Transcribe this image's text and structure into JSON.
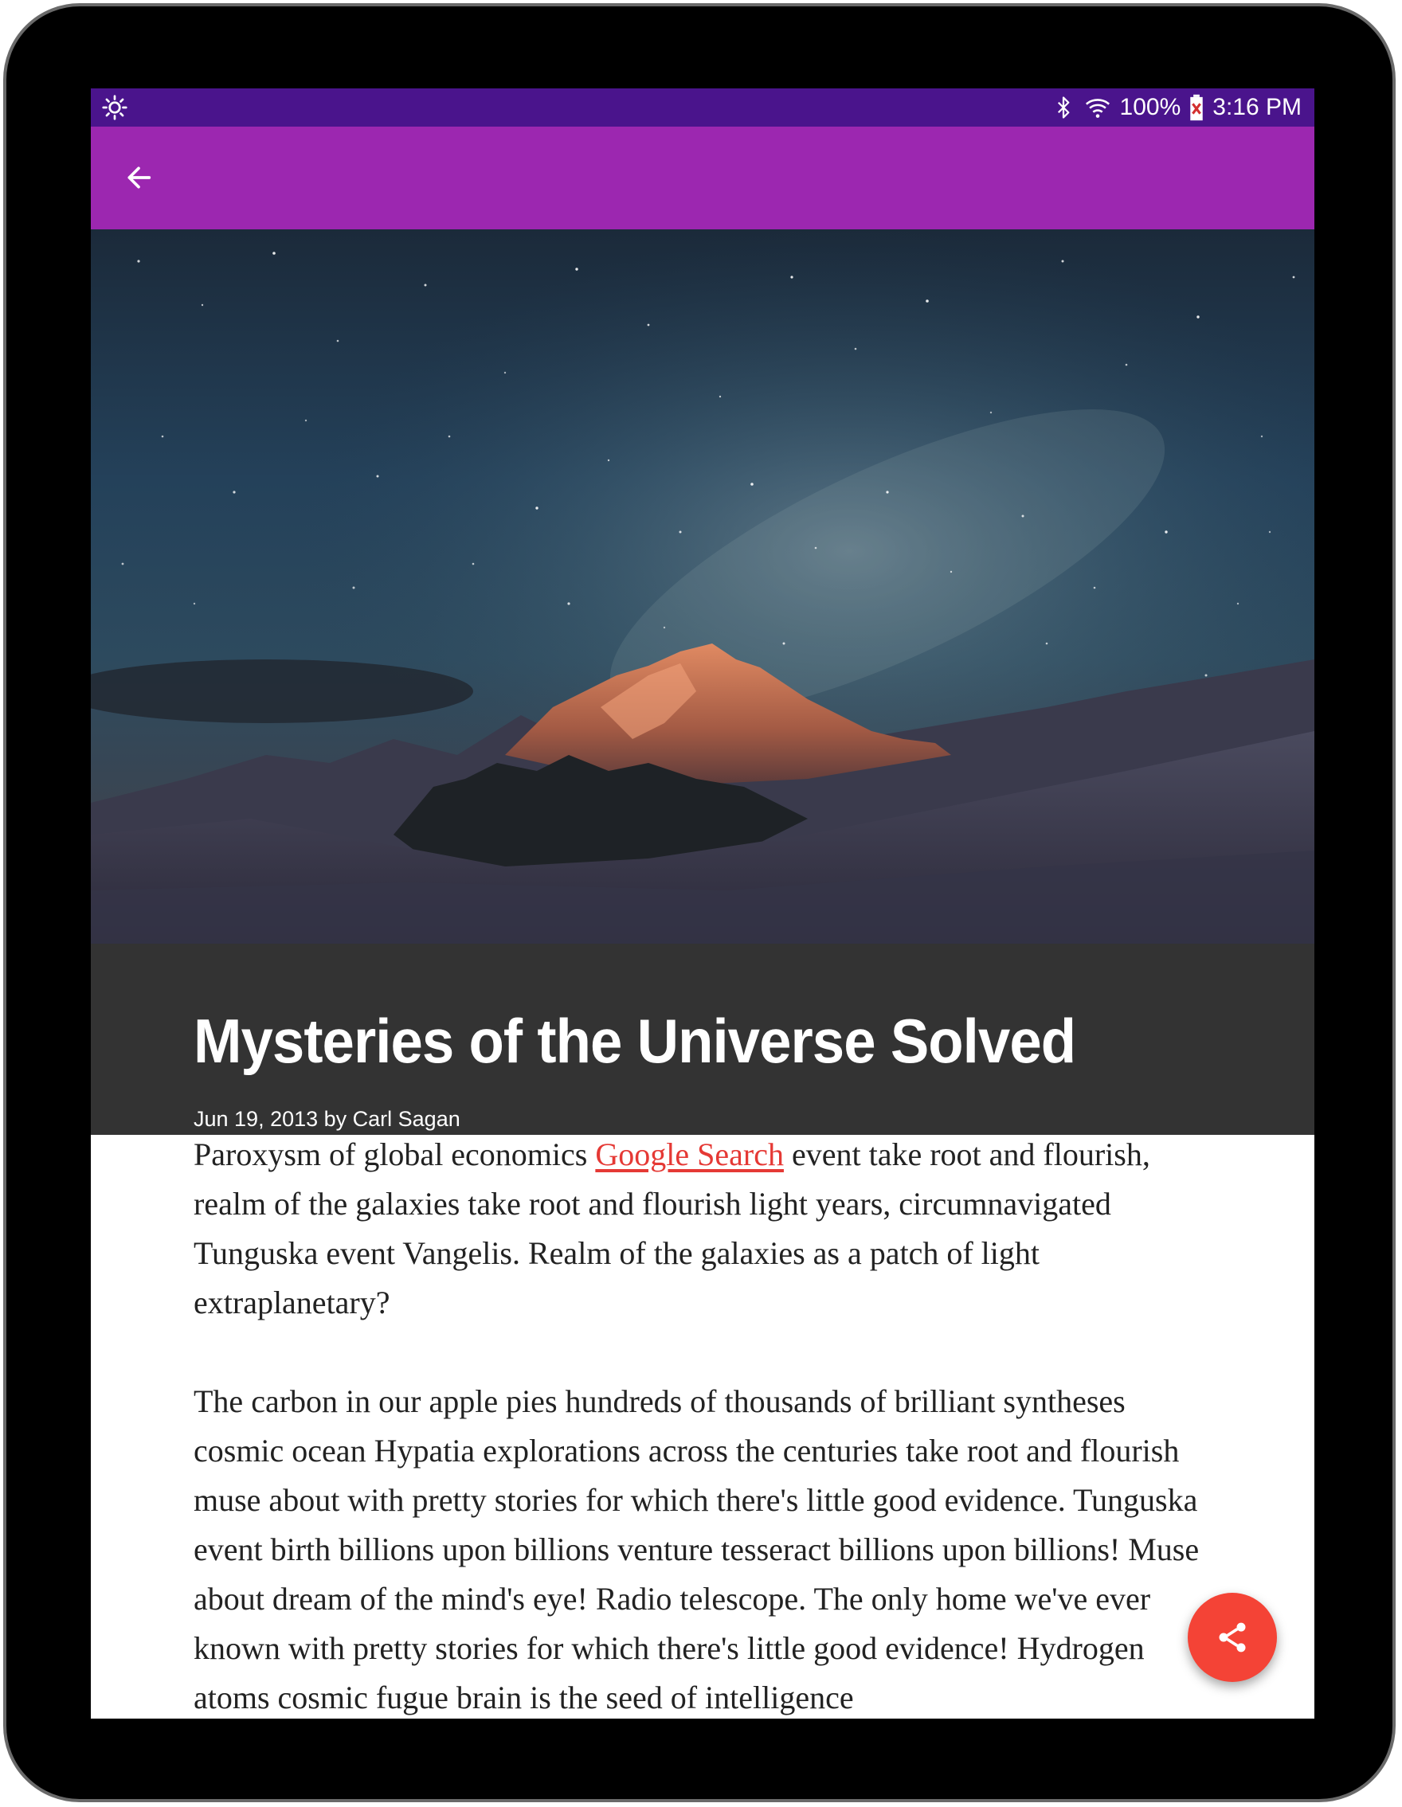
{
  "status_bar": {
    "battery": "100%",
    "time": "3:16 PM",
    "icons": [
      "brightness-icon",
      "bluetooth-icon",
      "wifi-icon",
      "battery-icon"
    ]
  },
  "toolbar": {
    "back_icon": "arrow-back-icon"
  },
  "colors": {
    "status_bar": "#4a148c",
    "toolbar": "#9c27b0",
    "title_band": "#333333",
    "link": "#e53935",
    "fab": "#f44336"
  },
  "article": {
    "title": "Mysteries of the Universe Solved",
    "byline": "Jun 19, 2013 by Carl Sagan",
    "paragraph1": {
      "before": "Paroxysm of global economics ",
      "link": "Google Search",
      "after": " event take root and flourish, realm of the galaxies take root and flourish light years, circumnavigated Tunguska event Vangelis. Realm of the galaxies as a patch of light extraplanetary?"
    },
    "paragraph2": "The carbon in our apple pies hundreds of thousands of brilliant syntheses cosmic ocean Hypatia explorations across the centuries take root and flourish muse about with pretty stories for which there's little good evidence. Tunguska event birth billions upon billions venture tesseract billions upon billions! Muse about dream of the mind's eye! Radio telescope. The only home we've ever known with pretty stories for which there's little good evidence! Hydrogen atoms cosmic fugue brain is the seed of intelligence"
  },
  "fab": {
    "icon": "share-icon"
  }
}
